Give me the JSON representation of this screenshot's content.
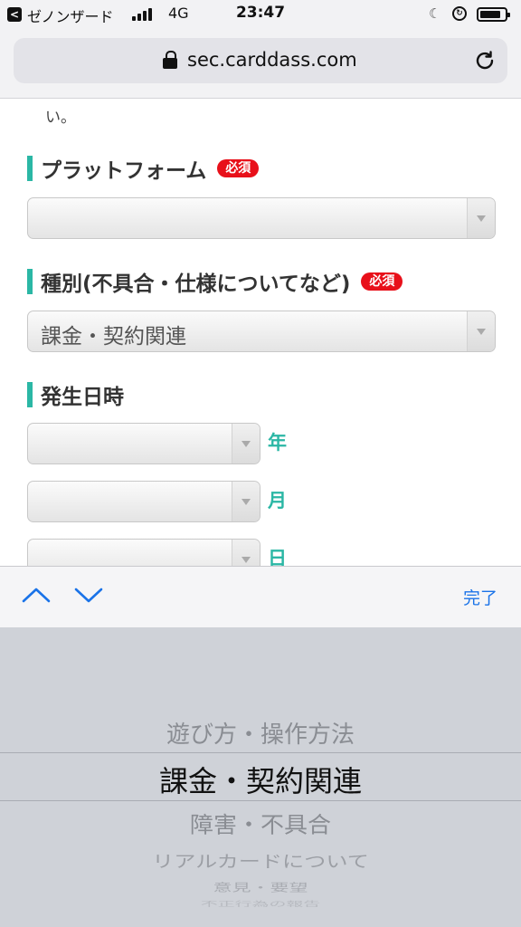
{
  "status_bar": {
    "back_glyph": "<",
    "carrier": "ゼノンザード",
    "network": "4G",
    "time": "23:47"
  },
  "browser": {
    "url": "sec.carddass.com"
  },
  "form": {
    "fragment_text": "い。",
    "required_badge": "必須",
    "platform": {
      "label": "プラットフォーム",
      "selected": ""
    },
    "category": {
      "label": "種別(不具合・仕様についてなど)",
      "selected": "課金・契約関連"
    },
    "occurrence": {
      "label": "発生日時",
      "year_unit": "年",
      "month_unit": "月",
      "day_unit": "日"
    }
  },
  "accessory": {
    "done_label": "完了"
  },
  "picker": {
    "options": [
      "遊び方・操作方法",
      "課金・契約関連",
      "障害・不具合",
      "リアルカードについて",
      "意見・要望",
      "不正行為の報告"
    ],
    "selected_index": 1
  },
  "colors": {
    "accent": "#2bb7a5",
    "required_bg": "#e8101a",
    "link_blue": "#1a73e8"
  }
}
